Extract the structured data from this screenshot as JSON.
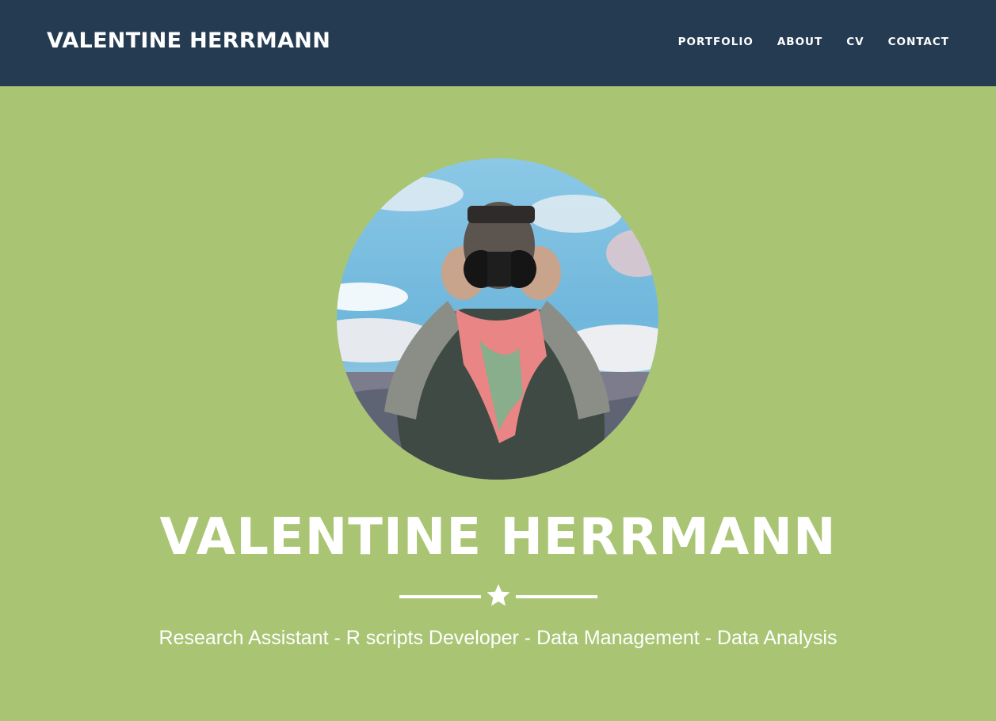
{
  "header": {
    "brand": "VALENTINE HERRMANN",
    "nav": [
      {
        "label": "PORTFOLIO"
      },
      {
        "label": "ABOUT"
      },
      {
        "label": "CV"
      },
      {
        "label": "CONTACT"
      }
    ]
  },
  "hero": {
    "title": "VALENTINE HERRMANN",
    "subtitle": "Research Assistant - R scripts Developer - Data Management - Data Analysis",
    "divider_icon": "star-icon"
  },
  "colors": {
    "navbar_bg": "#253B52",
    "hero_bg": "#A9C574",
    "text": "#FFFFFF"
  }
}
